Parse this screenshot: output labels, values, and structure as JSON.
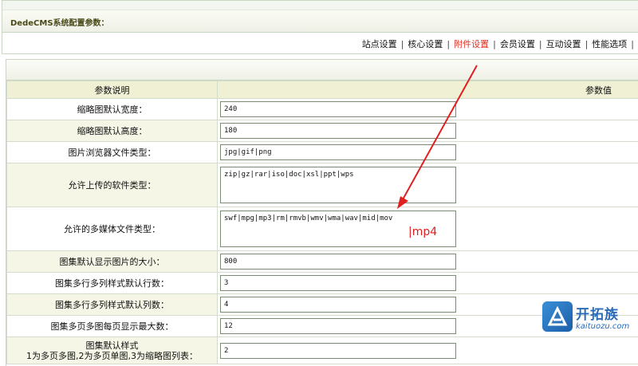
{
  "header": {
    "title": "DedeCMS系统配置参数：",
    "tabs": [
      {
        "label": "站点设置",
        "active": false
      },
      {
        "label": "核心设置",
        "active": false
      },
      {
        "label": "附件设置",
        "active": true
      },
      {
        "label": "会员设置",
        "active": false
      },
      {
        "label": "互动设置",
        "active": false
      },
      {
        "label": "性能选项",
        "active": false
      }
    ],
    "separator": "|"
  },
  "table": {
    "col_label": "参数说明",
    "col_value": "参数值",
    "rows": [
      {
        "label": "缩略图默认宽度：",
        "value": "240"
      },
      {
        "label": "缩略图默认高度：",
        "value": "180"
      },
      {
        "label": "图片浏览器文件类型：",
        "value": "jpg|gif|png"
      },
      {
        "label": "允许上传的软件类型：",
        "value": "zip|gz|rar|iso|doc|xsl|ppt|wps"
      },
      {
        "label": "允许的多媒体文件类型：",
        "value": "swf|mpg|mp3|rm|rmvb|wmv|wma|wav|mid|mov"
      },
      {
        "label": "图集默认显示图片的大小：",
        "value": "800"
      },
      {
        "label": "图集多行多列样式默认行数：",
        "value": "3"
      },
      {
        "label": "图集多行多列样式默认列数：",
        "value": "4"
      },
      {
        "label": "图集多页多图每页显示最大数：",
        "value": "12"
      },
      {
        "label_line1": "图集默认样式",
        "label_line2": "1为多页多图,2为多页单图,3为缩略图列表：",
        "value": "2"
      }
    ]
  },
  "annotation": {
    "text": "|mp4",
    "color": "#e02020"
  },
  "watermark": {
    "name": "开拓族",
    "url": "kaituozu.com",
    "color": "#2a6bb8"
  },
  "colors": {
    "active_tab": "#e03020",
    "header_row_bg": "#eff0d4",
    "label_row_bg": "#f5f6e6"
  }
}
